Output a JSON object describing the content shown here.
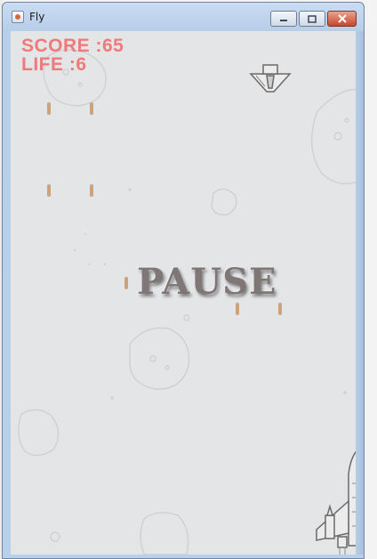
{
  "window": {
    "title": "Fly",
    "buttons": {
      "minimize": "minimize-icon",
      "maximize": "maximize-icon",
      "close": "close-icon"
    }
  },
  "hud": {
    "score_text": "SCORE :65",
    "life_text": "LIFE  :6",
    "score": 65,
    "life": 6,
    "color": "#f07a7a"
  },
  "overlay": {
    "state_text": "PAUSE"
  },
  "colors": {
    "background": "#e4e5e7",
    "bullet": "#c9a47c",
    "sketch_lines": "#a9a9a9"
  },
  "sprites": {
    "bullets": 8,
    "enemy_planes": 1,
    "player_ship": 1
  }
}
